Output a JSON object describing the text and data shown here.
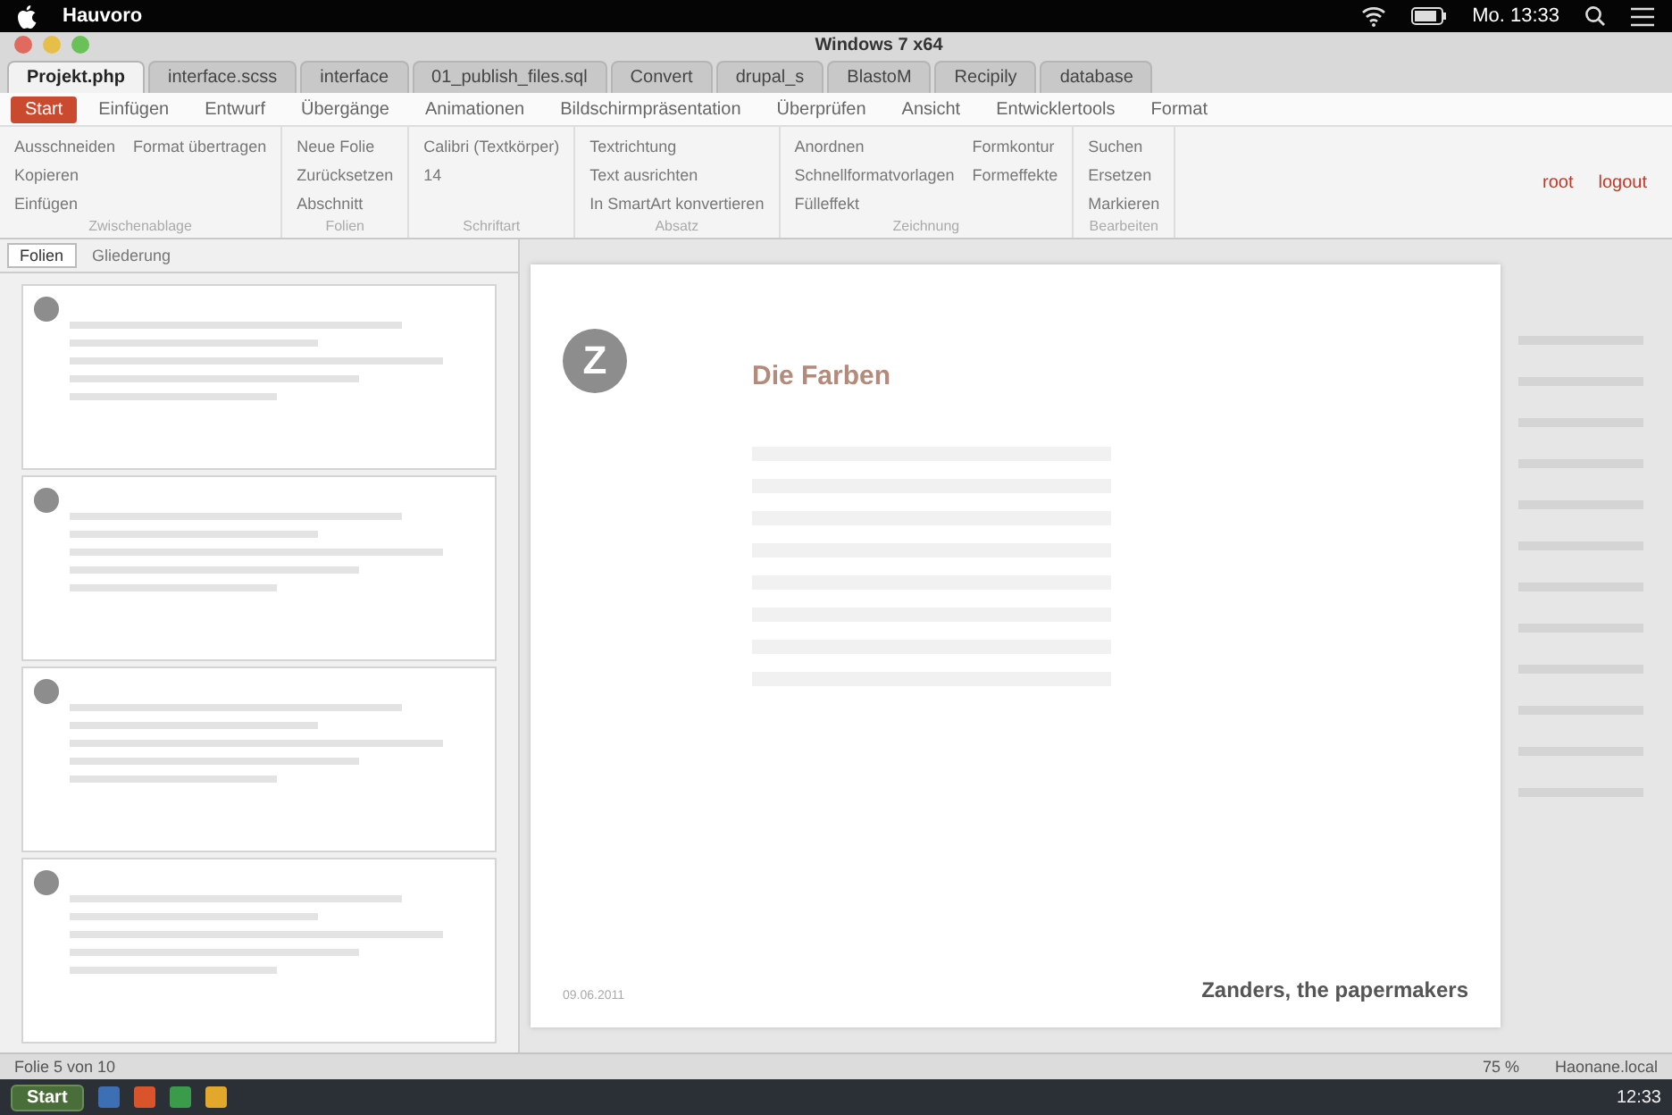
{
  "menubar": {
    "app": "Hauvoro",
    "clock": "Mo. 13:33"
  },
  "window": {
    "title": "Windows 7 x64"
  },
  "browser_tabs": [
    {
      "label": "Projekt.php",
      "selected": true
    },
    {
      "label": "interface.scss",
      "selected": false
    },
    {
      "label": "interface",
      "selected": false
    },
    {
      "label": "01_publish_files.sql",
      "selected": false
    },
    {
      "label": "Convert",
      "selected": false
    },
    {
      "label": "drupal_s",
      "selected": false
    },
    {
      "label": "BlastoM",
      "selected": false
    },
    {
      "label": "Recipily",
      "selected": false
    },
    {
      "label": "database",
      "selected": false
    }
  ],
  "ribbon_tabs": [
    {
      "label": "Start",
      "selected": true
    },
    {
      "label": "Einfügen",
      "selected": false
    },
    {
      "label": "Entwurf",
      "selected": false
    },
    {
      "label": "Übergänge",
      "selected": false
    },
    {
      "label": "Animationen",
      "selected": false
    },
    {
      "label": "Bildschirmpräsentation",
      "selected": false
    },
    {
      "label": "Überprüfen",
      "selected": false
    },
    {
      "label": "Ansicht",
      "selected": false
    },
    {
      "label": "Entwicklertools",
      "selected": false
    },
    {
      "label": "Format",
      "selected": false
    }
  ],
  "ribbon_groups": [
    {
      "title": "Zwischenablage",
      "items": [
        "Ausschneiden",
        "Kopieren",
        "Einfügen",
        "Format übertragen"
      ]
    },
    {
      "title": "Folien",
      "items": [
        "Neue Folie",
        "Zurücksetzen",
        "Abschnitt"
      ]
    },
    {
      "title": "Schriftart",
      "items": [
        "Calibri (Textkörper)",
        "14"
      ]
    },
    {
      "title": "Absatz",
      "items": [
        "Textrichtung",
        "Text ausrichten",
        "In SmartArt konvertieren"
      ]
    },
    {
      "title": "Zeichnung",
      "items": [
        "Anordnen",
        "Schnellformatvorlagen",
        "Fülleffekt",
        "Formkontur",
        "Formeffekte"
      ]
    },
    {
      "title": "Bearbeiten",
      "items": [
        "Suchen",
        "Ersetzen",
        "Markieren"
      ]
    }
  ],
  "session": {
    "user": "root",
    "logout": "logout"
  },
  "slide_pane": {
    "tabs": [
      {
        "label": "Folien",
        "selected": true
      },
      {
        "label": "Gliederung",
        "selected": false
      }
    ]
  },
  "slide": {
    "logo": "Z",
    "title": "Die Farben",
    "footer_date": "09.06.2011",
    "brand": "Zanders, the papermakers"
  },
  "status_bar": {
    "slide": "Folie 5 von 10",
    "zoom": "75 %",
    "host": "Haonane.local"
  },
  "taskbar": {
    "start": "Start",
    "clock": "12:33"
  }
}
